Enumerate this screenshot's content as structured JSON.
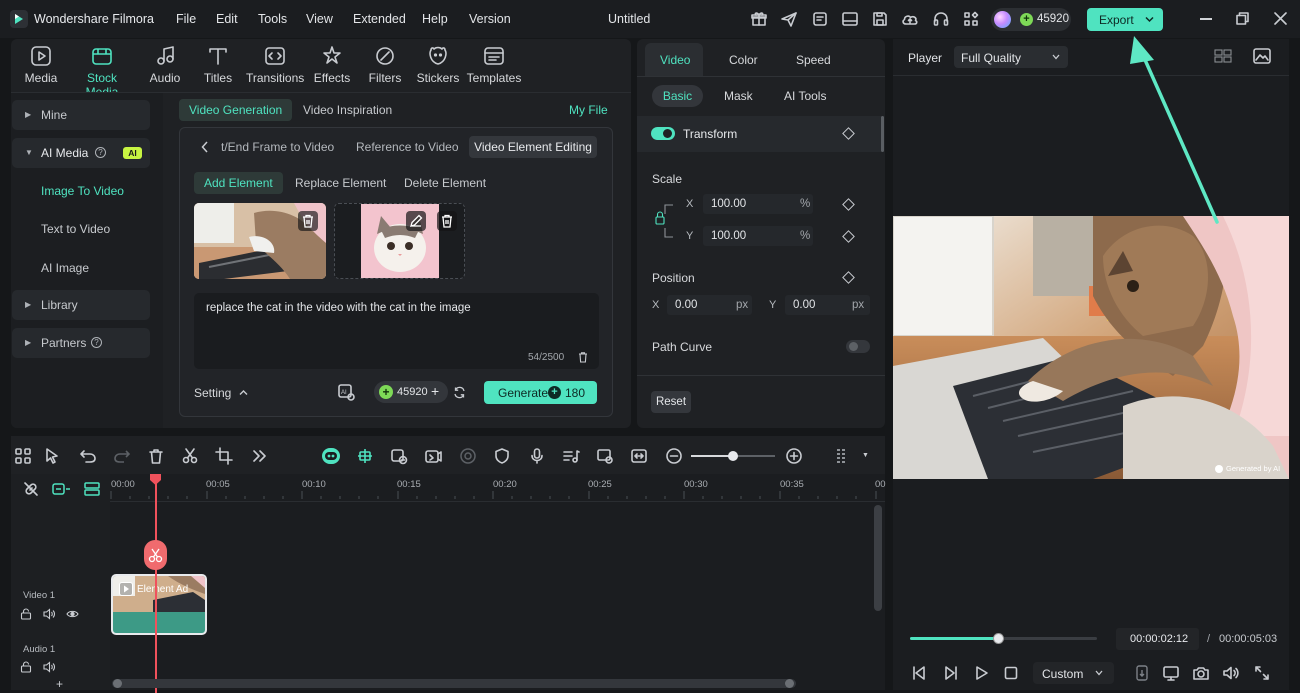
{
  "app": {
    "name": "Wondershare Filmora",
    "document_title": "Untitled",
    "credits": "45920",
    "export_label": "Export"
  },
  "menu": [
    "File",
    "Edit",
    "Tools",
    "View",
    "Extended",
    "Help",
    "Version"
  ],
  "toolbar": [
    {
      "label": "Media",
      "icon": "media-icon"
    },
    {
      "label": "Stock Media",
      "icon": "stock-media-icon",
      "active": true
    },
    {
      "label": "Audio",
      "icon": "music-note-icon"
    },
    {
      "label": "Titles",
      "icon": "titles-icon"
    },
    {
      "label": "Transitions",
      "icon": "transitions-icon"
    },
    {
      "label": "Effects",
      "icon": "effects-icon"
    },
    {
      "label": "Filters",
      "icon": "filters-icon"
    },
    {
      "label": "Stickers",
      "icon": "stickers-icon"
    },
    {
      "label": "Templates",
      "icon": "templates-icon"
    }
  ],
  "sidebar": {
    "mine": "Mine",
    "ai_media": "AI Media",
    "ai_badge": "AI",
    "image_to_video": "Image To Video",
    "text_to_video": "Text to Video",
    "ai_image": "AI Image",
    "library": "Library",
    "partners": "Partners"
  },
  "ai_panel": {
    "tab_generation": "Video Generation",
    "tab_inspiration": "Video Inspiration",
    "my_file": "My File",
    "mode_tab_1": "t/End Frame to Video",
    "mode_tab_2": "Reference to Video",
    "mode_tab_3": "Video Element Editing",
    "sub_add": "Add Element",
    "sub_replace": "Replace Element",
    "sub_delete": "Delete Element",
    "prompt": "replace the cat in the video with the cat in the image",
    "char_count": "54/2500",
    "setting": "Setting",
    "credits": "45920",
    "generate": "Generate",
    "generate_cost": "180"
  },
  "properties": {
    "tabs": [
      "Video",
      "Color",
      "Speed"
    ],
    "subtabs": [
      "Basic",
      "Mask",
      "AI Tools"
    ],
    "transform": "Transform",
    "scale": "Scale",
    "scale_x_label": "X",
    "scale_x": "100.00",
    "scale_y_label": "Y",
    "scale_y": "100.00",
    "percent": "%",
    "position": "Position",
    "pos_x_label": "X",
    "pos_x": "0.00",
    "pos_y_label": "Y",
    "pos_y": "0.00",
    "px": "px",
    "path_curve": "Path Curve",
    "reset": "Reset"
  },
  "player": {
    "label": "Player",
    "quality": "Full Quality",
    "watermark": "Generated by AI",
    "current_time": "00:00:02:12",
    "separator": "/",
    "total_time": "00:00:05:03",
    "progress": 0.47,
    "custom": "Custom"
  },
  "timeline": {
    "ruler": [
      "00:00",
      "00:05",
      "00:10",
      "00:15",
      "00:20",
      "00:25",
      "00:30",
      "00:35",
      "00"
    ],
    "video_track": "Video 1",
    "audio_track": "Audio 1",
    "clip_label": "Element Ad"
  },
  "colors": {
    "accent": "#4fe3c0",
    "playhead": "#f0525c",
    "background": "#151719"
  }
}
